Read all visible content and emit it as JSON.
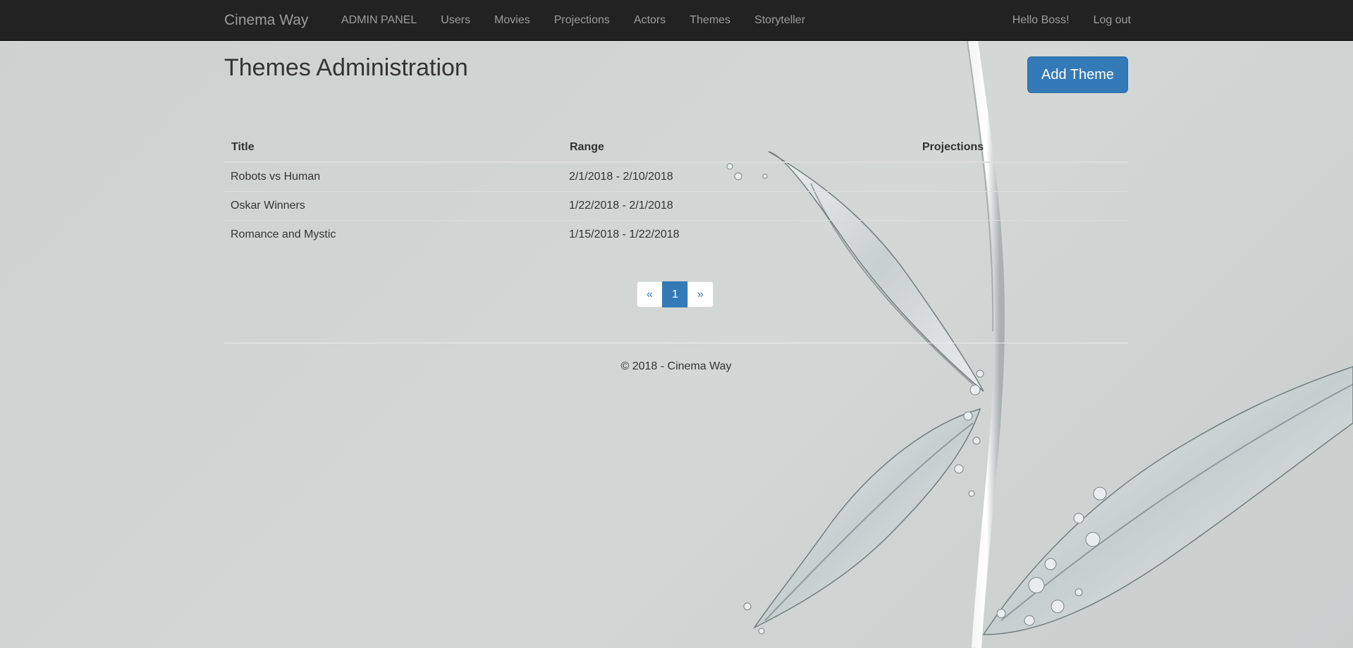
{
  "navbar": {
    "brand": "Cinema Way",
    "links": [
      "ADMIN PANEL",
      "Users",
      "Movies",
      "Projections",
      "Actors",
      "Themes",
      "Storyteller"
    ],
    "greeting": "Hello Boss!",
    "logout": "Log out"
  },
  "page": {
    "title": "Themes Administration",
    "add_button": "Add Theme"
  },
  "table": {
    "headers": [
      "Title",
      "Range",
      "Projections"
    ],
    "rows": [
      {
        "title": "Robots vs Human",
        "range": "2/1/2018 - 2/10/2018",
        "projections": ""
      },
      {
        "title": "Oskar Winners",
        "range": "1/22/2018 - 2/1/2018",
        "projections": ""
      },
      {
        "title": "Romance and Mystic",
        "range": "1/15/2018 - 1/22/2018",
        "projections": ""
      }
    ]
  },
  "pagination": {
    "prev": "«",
    "current": "1",
    "next": "»"
  },
  "footer": {
    "text": "© 2018 - Cinema Way"
  },
  "colors": {
    "navbar_bg": "#222222",
    "primary": "#337ab7"
  }
}
